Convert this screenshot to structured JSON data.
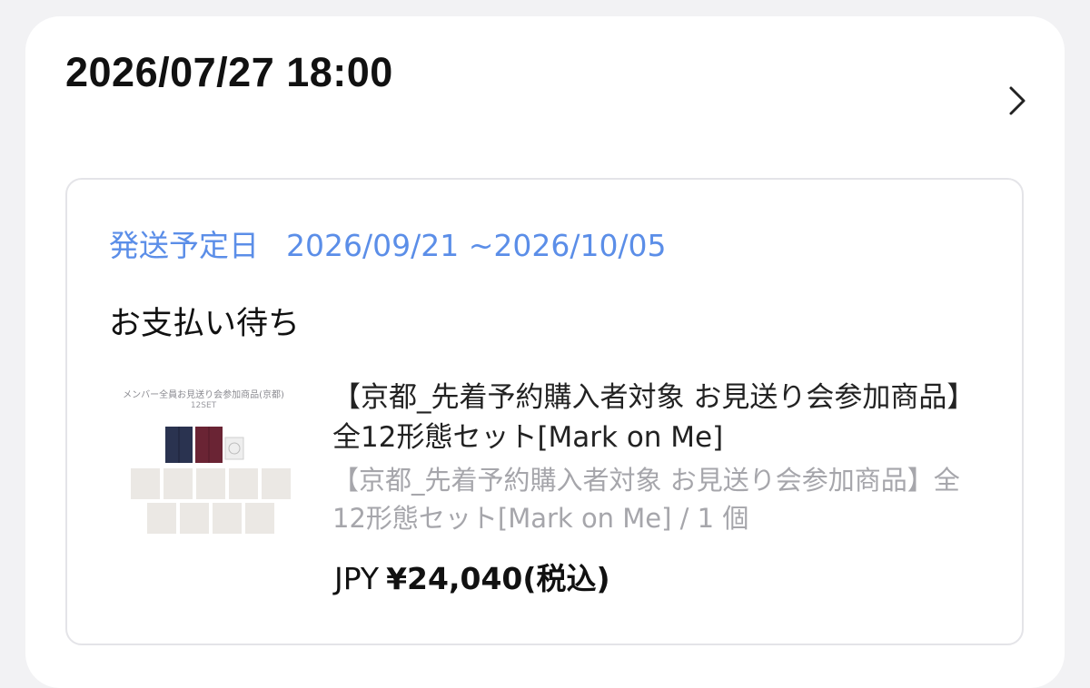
{
  "order": {
    "datetime": "2026/07/27 18:00",
    "chevron_icon": "chevron-right-icon"
  },
  "shipping": {
    "label": "発送予定日",
    "range": "2026/09/21 ~2026/10/05",
    "color": "#5b8ee8"
  },
  "status": "お支払い待ち",
  "product": {
    "thumbnail_caption": "メンバー全員お見送り会参加商品(京都)",
    "thumbnail_sub": "12SET",
    "title": "【京都_先着予約購入者対象 お見送り会参加商品】全12形態セット[Mark on Me]",
    "variant": "【京都_先着予約購入者対象 お見送り会参加商品】全12形態セット[Mark on Me] / 1 個",
    "price_currency": "JPY",
    "price_value": "¥24,040(税込)"
  }
}
